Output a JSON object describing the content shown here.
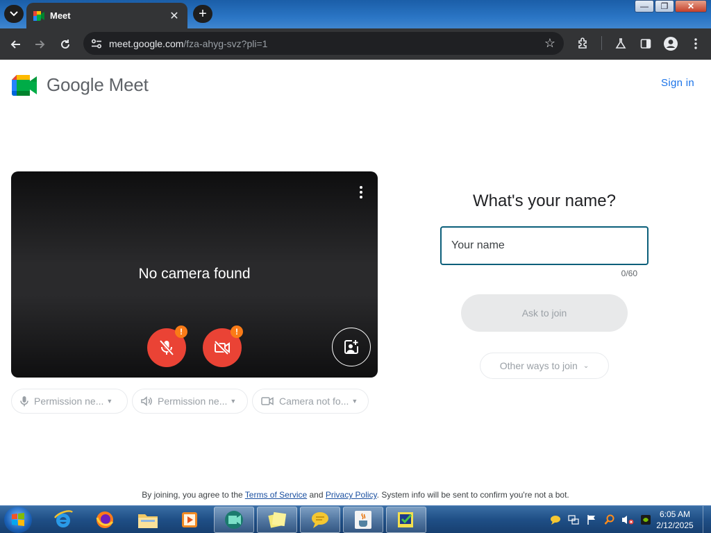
{
  "browser": {
    "tab_title": "Meet",
    "tab_close": "✕",
    "new_tab": "+",
    "url_host": "meet.google.com",
    "url_path": "/fza-ahyg-svz?pli=1",
    "window_controls": {
      "minimize": "—",
      "restore": "❐",
      "close": "✕"
    }
  },
  "meet": {
    "logo_text": "Google Meet",
    "sign_in": "Sign in",
    "preview": {
      "message": "No camera found",
      "warning_badge": "!"
    },
    "chips": [
      {
        "label": "Permission ne...",
        "icon": "mic-icon"
      },
      {
        "label": "Permission ne...",
        "icon": "speaker-icon"
      },
      {
        "label": "Camera not fo...",
        "icon": "camera-icon"
      }
    ],
    "join": {
      "title": "What's your name?",
      "name_placeholder": "Your name",
      "name_value": "",
      "counter": "0/60",
      "ask_button": "Ask to join",
      "other_ways": "Other ways to join"
    },
    "footer": {
      "prefix": "By joining, you agree to the ",
      "terms": "Terms of Service",
      "and": " and ",
      "privacy": "Privacy Policy",
      "suffix": ". System info will be sent to confirm you're not a bot."
    }
  },
  "taskbar": {
    "time": "6:05 AM",
    "date": "2/12/2025"
  },
  "colors": {
    "meet_blue": "#1a73e8",
    "mic_off_red": "#ea4335",
    "warning_orange": "#fa7b17",
    "input_border": "#0b5f7a"
  }
}
